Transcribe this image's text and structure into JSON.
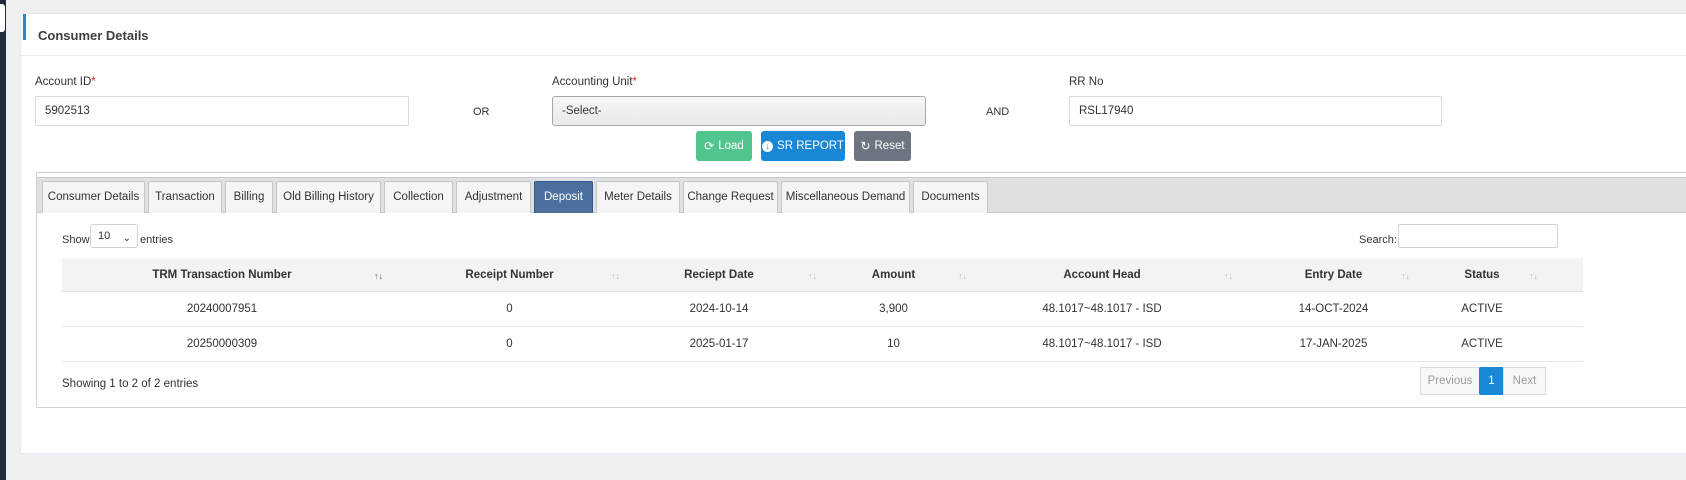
{
  "section": {
    "title": "Consumer Details"
  },
  "form": {
    "account_id": {
      "label": "Account ID",
      "required_mark": "*",
      "value": "5902513"
    },
    "or_label": "OR",
    "accounting_unit": {
      "label": "Accounting Unit",
      "required_mark": "*",
      "selected": "-Select-"
    },
    "and_label": "AND",
    "rr_no": {
      "label": "RR No",
      "value": "RSL17940"
    }
  },
  "buttons": {
    "load": "Load",
    "sr_report": "SR REPORT",
    "reset": "Reset"
  },
  "tabs": [
    {
      "label": "Consumer Details"
    },
    {
      "label": "Transaction"
    },
    {
      "label": "Billing"
    },
    {
      "label": "Old Billing History"
    },
    {
      "label": "Collection"
    },
    {
      "label": "Adjustment"
    },
    {
      "label": "Deposit",
      "active": true
    },
    {
      "label": "Meter Details"
    },
    {
      "label": "Change Request"
    },
    {
      "label": "Miscellaneous Demand"
    },
    {
      "label": "Documents"
    }
  ],
  "table_controls": {
    "show_label": "Show",
    "entries_value": "10",
    "entries_label": "entries",
    "search_label": "Search:"
  },
  "table": {
    "columns": [
      "TRM Transaction Number",
      "Receipt Number",
      "Reciept Date",
      "Amount",
      "Account Head",
      "Entry Date",
      "Status"
    ],
    "rows": [
      [
        "20240007951",
        "0",
        "2024-10-14",
        "3,900",
        "48.1017~48.1017 - ISD",
        "14-OCT-2024",
        "ACTIVE"
      ],
      [
        "20250000309",
        "0",
        "2025-01-17",
        "10",
        "48.1017~48.1017 - ISD",
        "17-JAN-2025",
        "ACTIVE"
      ]
    ],
    "info": "Showing 1 to 2 of 2 entries"
  },
  "pagination": {
    "previous": "Previous",
    "current": "1",
    "next": "Next"
  },
  "colors": {
    "primary": "#1787d6",
    "success": "#52c48d",
    "secondary": "#6c7581",
    "active_tab": "#4b6f9e",
    "required": "#e02a2a"
  }
}
